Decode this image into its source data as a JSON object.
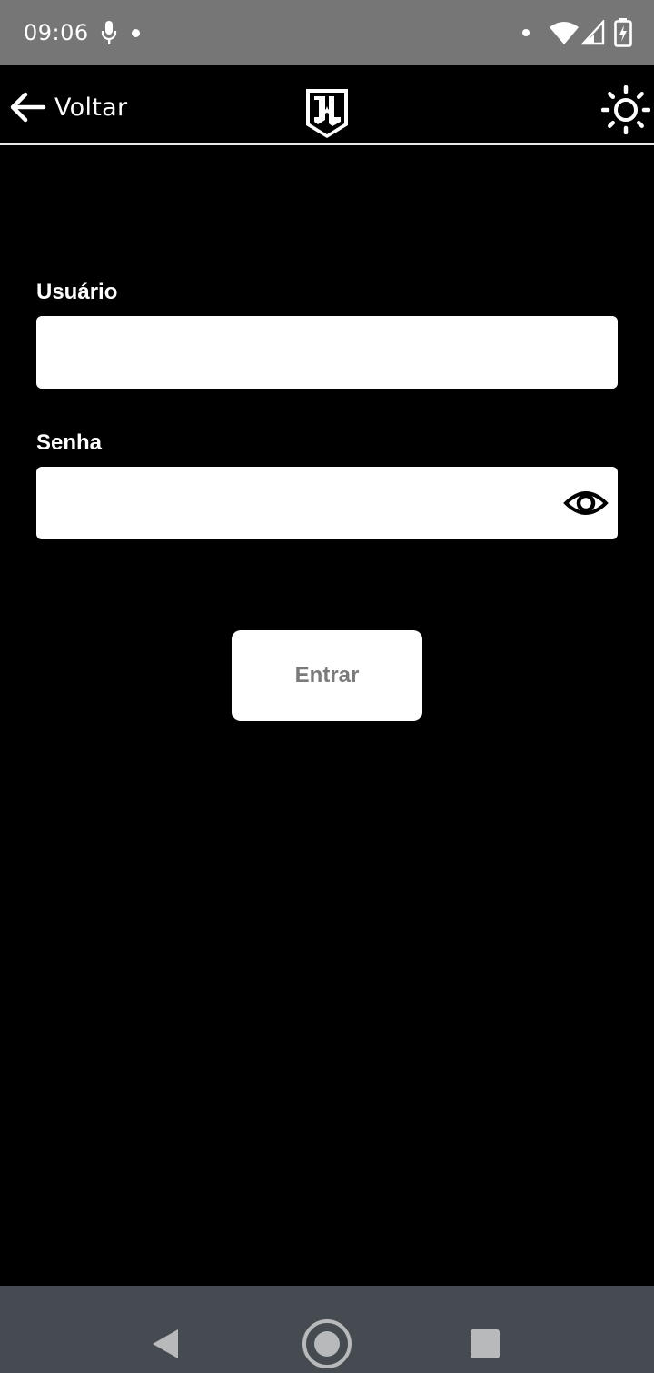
{
  "status_bar": {
    "time": "09:06",
    "icons": [
      "mic-icon",
      "notification-dot-icon",
      "wifi-icon",
      "signal-icon",
      "battery-charging-icon"
    ]
  },
  "header": {
    "back_label": "Voltar",
    "back_icon": "arrow-left-icon",
    "logo_icon": "justice-league-logo-icon",
    "theme_icon": "sun-icon"
  },
  "form": {
    "user_label": "Usuário",
    "user_value": "",
    "password_label": "Senha",
    "password_value": "",
    "password_toggle_icon": "eye-icon",
    "submit_label": "Entrar"
  },
  "nav_bar": {
    "icons": [
      "nav-back-icon",
      "nav-home-icon",
      "nav-recents-icon"
    ]
  },
  "colors": {
    "background": "#000000",
    "status_bar": "#767676",
    "nav_bar": "#454b50",
    "input_bg": "#ffffff",
    "button_text": "#7a7a7a"
  }
}
